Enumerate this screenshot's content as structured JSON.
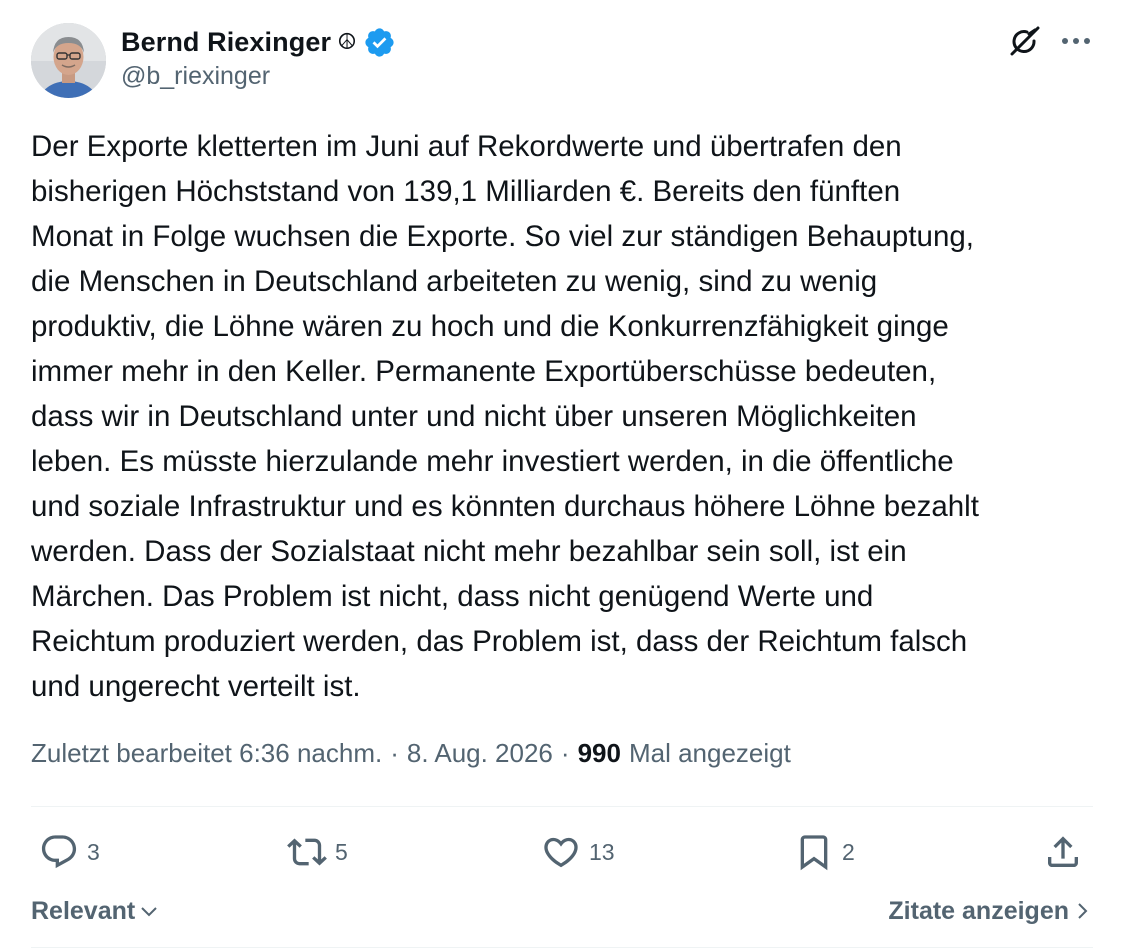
{
  "author": {
    "name": "Bernd Riexinger",
    "emoji": "☮",
    "handle": "@b_riexinger",
    "verified": true,
    "verified_color": "#1d9bf0"
  },
  "header_icons": {
    "grok": "grok-icon",
    "more": "more-dots-icon"
  },
  "tweet": {
    "text": "Der Exporte kletterten im Juni auf Rekordwerte und übertrafen den\nbisherigen Höchststand von 139,1 Milliarden €. Bereits den fünften\nMonat in Folge wuchsen die Exporte. So viel zur ständigen Behauptung,\ndie Menschen in Deutschland arbeiteten zu wenig, sind zu wenig\nproduktiv, die Löhne wären zu hoch und die Konkurrenzfähigkeit ginge\nimmer mehr in den Keller. Permanente Exportüberschüsse bedeuten,\ndass wir in Deutschland unter und nicht über unseren Möglichkeiten\nleben. Es müsste hierzulande mehr investiert werden, in die öffentliche\nund soziale Infrastruktur und es könnten durchaus höhere Löhne bezahlt\nwerden. Dass der Sozialstaat nicht mehr bezahlbar sein soll, ist ein\nMärchen. Das Problem ist nicht, dass nicht genügend Werte und\nReichtum produziert werden, das Problem ist, dass der Reichtum falsch\nund ungerecht verteilt ist."
  },
  "meta": {
    "edited_label": "Zuletzt bearbeitet 6:36 nachm.",
    "separator": "·",
    "date": "8. Aug. 2026",
    "views_count": "990",
    "views_label": "Mal angezeigt"
  },
  "actions": {
    "replies": {
      "icon": "reply-icon",
      "count": "3"
    },
    "reposts": {
      "icon": "repost-icon",
      "count": "5"
    },
    "likes": {
      "icon": "heart-icon",
      "count": "13"
    },
    "bookmarks": {
      "icon": "bookmark-icon",
      "count": "2"
    },
    "share": {
      "icon": "share-icon"
    }
  },
  "footer": {
    "sort_label": "Relevant",
    "quotes_label": "Zitate anzeigen"
  },
  "colors": {
    "text_primary": "#0f1419",
    "text_secondary": "#536471",
    "divider": "#eff3f4",
    "accent": "#1d9bf0"
  }
}
